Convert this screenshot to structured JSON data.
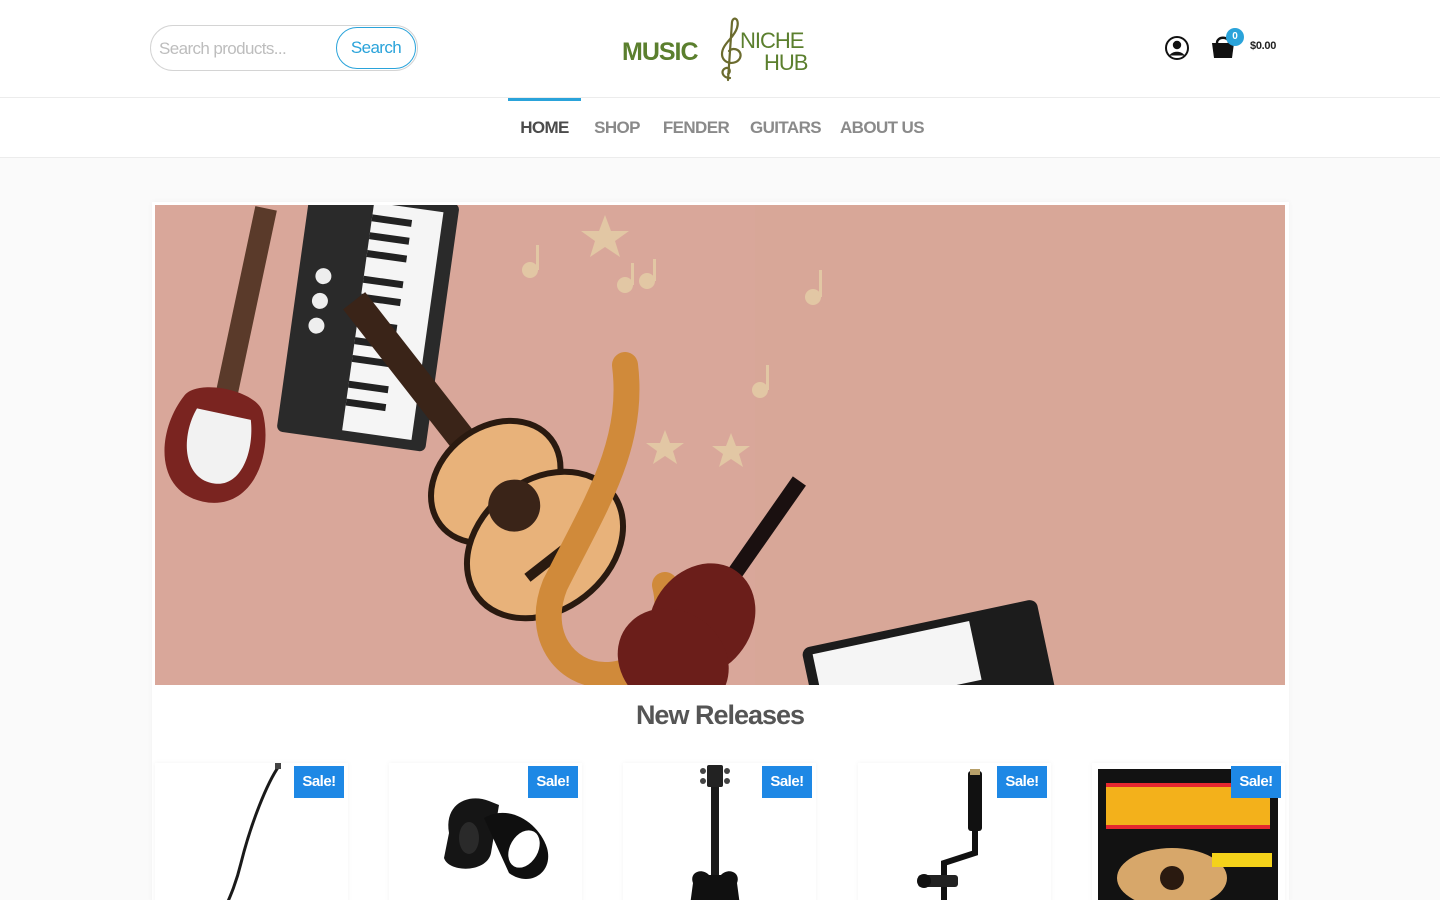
{
  "header": {
    "search": {
      "placeholder": "Search products...",
      "value": "",
      "button_label": "Search"
    },
    "logo": {
      "text_main": "MUSIC",
      "text_top": "NICHE",
      "text_bottom": "HUB",
      "color": "#5b7f2e"
    },
    "cart": {
      "count": "0",
      "total": "$0.00"
    },
    "accent_color": "#2aa3da"
  },
  "nav": {
    "items": [
      {
        "label": "HOME",
        "active": true
      },
      {
        "label": "SHOP",
        "active": false
      },
      {
        "label": "FENDER",
        "active": false
      },
      {
        "label": "GUITARS",
        "active": false
      },
      {
        "label": "ABOUT US",
        "active": false
      }
    ]
  },
  "main": {
    "hero": {
      "alt": "Miniature musical instruments: electric guitar, keyboard, acoustic guitar, saxophone, violin and accordion with wooden music notes"
    },
    "section_title": "New Releases",
    "products": [
      {
        "badge": "Sale!",
        "icon": "guitar-cable-icon"
      },
      {
        "badge": "Sale!",
        "icon": "guitar-strap-icon"
      },
      {
        "badge": "Sale!",
        "icon": "bass-guitar-icon"
      },
      {
        "badge": "Sale!",
        "icon": "mic-stand-icon"
      },
      {
        "badge": "Sale!",
        "icon": "string-pack-icon"
      }
    ]
  },
  "colors": {
    "sale_badge": "#1e88e5",
    "cart_badge": "#2aa3da"
  }
}
